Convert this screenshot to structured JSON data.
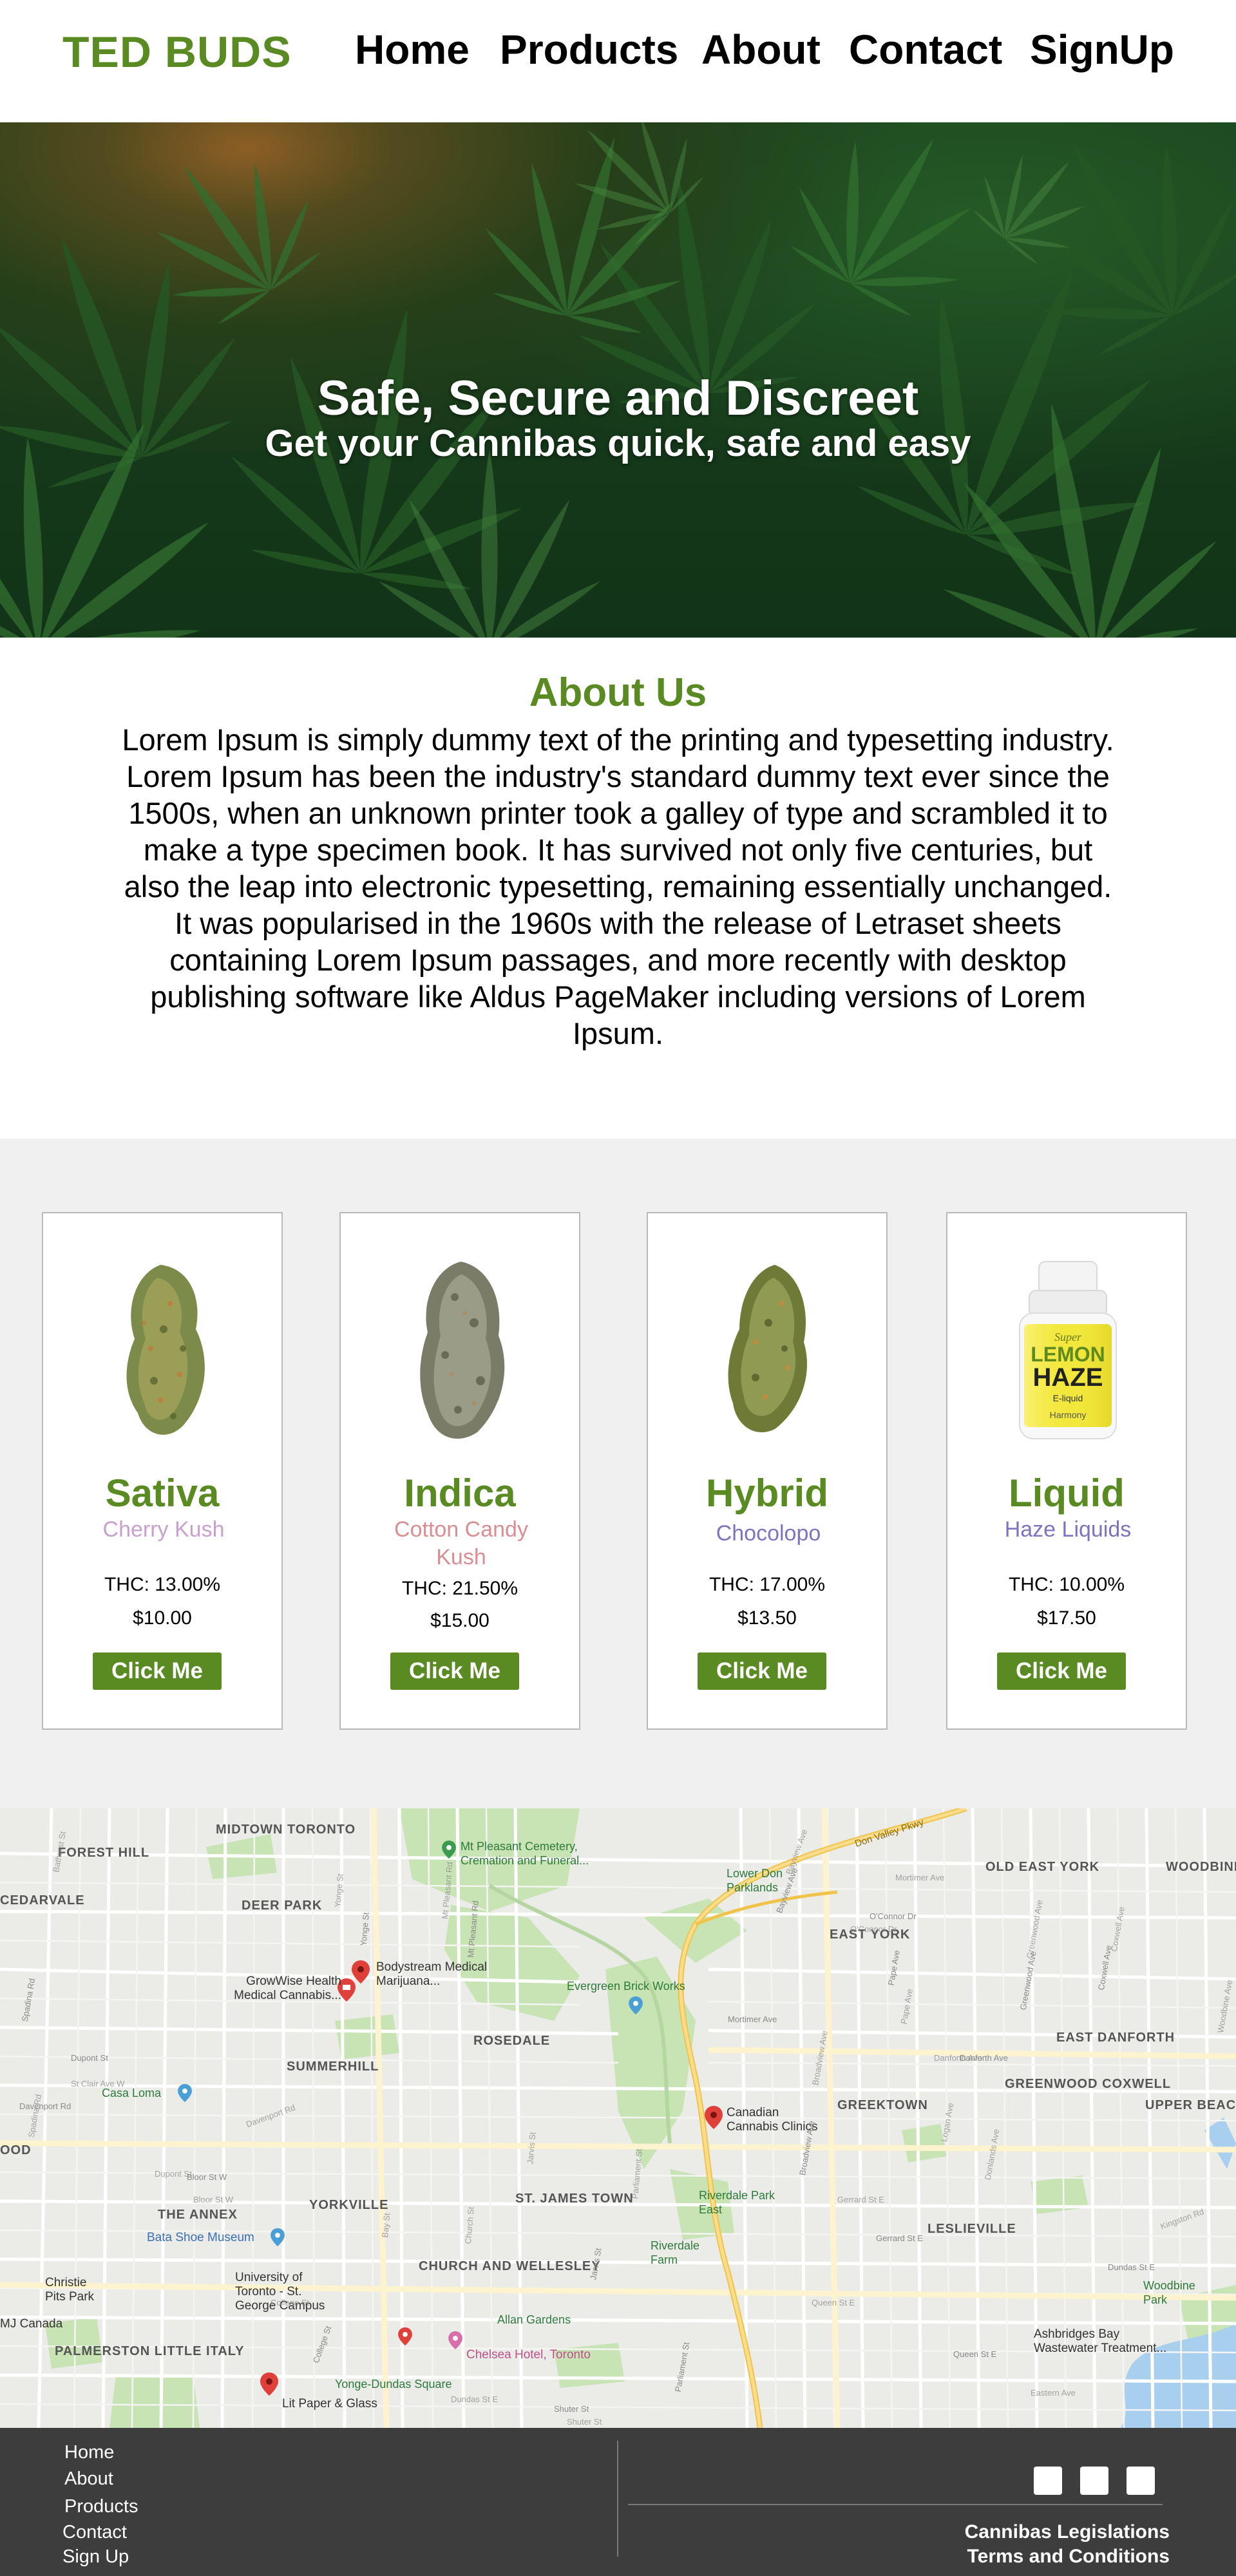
{
  "brand": {
    "name": "TED BUDS",
    "accent": "#5a8a22"
  },
  "nav": {
    "items": [
      "Home",
      "Products",
      "About",
      "Contact",
      "SignUp"
    ]
  },
  "hero": {
    "title": "Safe, Secure and Discreet",
    "subtitle": "Get your Cannibas quick, safe and easy"
  },
  "about": {
    "title": "About Us",
    "lines": [
      "Lorem Ipsum is simply dummy text of the printing and typesetting industry.",
      "Lorem Ipsum has been the industry's standard dummy text ever since the",
      "1500s, when an unknown printer took a galley of type and scrambled it to",
      "make a type specimen book. It has survived not only five centuries, but",
      "also the leap into electronic typesetting, remaining essentially unchanged.",
      "It was popularised in the 1960s with the release of Letraset sheets",
      "containing Lorem Ipsum passages, and more recently with desktop",
      "publishing software like Aldus PageMaker including versions of Lorem",
      "Ipsum."
    ]
  },
  "products": [
    {
      "name": "Sativa",
      "strain": "Cherry Kush",
      "strain_color": "#c9a0cd",
      "thc": "THC: 13.00%",
      "price": "$10.00",
      "button": "Click Me",
      "image": "cannabis-bud-icon"
    },
    {
      "name": "Indica",
      "strain": "Cotton Candy Kush",
      "strain_color": "#d98e93",
      "thc": "THC: 21.50%",
      "price": "$15.00",
      "button": "Click Me",
      "image": "cannabis-bud-icon"
    },
    {
      "name": "Hybrid",
      "strain": "Chocolopo",
      "strain_color": "#7e73c0",
      "thc": "THC: 17.00%",
      "price": "$13.50",
      "button": "Click Me",
      "image": "cannabis-bud-icon"
    },
    {
      "name": "Liquid",
      "strain": "Haze Liquids",
      "strain_color": "#7e73c0",
      "thc": "THC: 10.00%",
      "price": "$17.50",
      "button": "Click Me",
      "image": "e-liquid-bottle-icon",
      "bottle": {
        "top": "Super",
        "line1": "LEMON",
        "line2": "HAZE",
        "type": "E-liquid",
        "maker": "Harmony"
      }
    }
  ],
  "map": {
    "areas": [
      "MIDTOWN TORONTO",
      "FOREST HILL",
      "DEER PARK",
      "CEDARVALE",
      "SUMMERHILL",
      "ROSEDALE",
      "THE ANNEX",
      "YORKVILLE",
      "ST. JAMES TOWN",
      "CHURCH AND WELLESLEY",
      "PALMERSTON LITTLE ITALY",
      "OLD EAST YORK",
      "EAST YORK",
      "WOODBINE - LUMSDE",
      "EAST DANFORTH",
      "GREENWOOD COXWELL",
      "GREEKTOWN",
      "UPPER BEACH",
      "LESLIEVILLE",
      "OOD"
    ],
    "places": [
      "Mt Pleasant Cemetery, Cremation and Funeral...",
      "Lower Don Parklands",
      "Bodystream Medical Marijuana...",
      "GrowWise Health Medical Cannabis...",
      "Evergreen Brick Works",
      "Casa Loma",
      "Canadian Cannabis Clinics",
      "Riverdale Park East",
      "Riverdale Farm",
      "Bata Shoe Museum",
      "University of Toronto - St. George Campus",
      "Christie Pits Park",
      "MJ Canada",
      "Allan Gardens",
      "Chelsea Hotel, Toronto",
      "Yonge-Dundas Square",
      "Lit Paper & Glass",
      "Woodbine Park",
      "Ashbridges Bay Wastewater Treatment..."
    ],
    "roads": [
      "Don Valley Pkwy",
      "Bayview Ave",
      "Danforth Ave",
      "Gerrard St E",
      "Queen St E",
      "Dundas St E",
      "Bloor St W",
      "College St",
      "Jarvis St",
      "Parliament St",
      "Broadview Ave",
      "Pape Ave",
      "Greenwood Ave",
      "Coxwell Ave",
      "Mortimer Ave",
      "Davenport Rd",
      "Dupont St",
      "Spadina Rd",
      "Shuter St",
      "O'Connor Dr",
      "Yonge St",
      "Mt Pleasant Rd"
    ],
    "street_labels": [
      "Bathurst St",
      "Spadina Rd",
      "Dupont St",
      "St Clair Ave W",
      "Davenport Rd",
      "Yonge St",
      "Mt Pleasant Rd",
      "Bloor St W",
      "Bay St",
      "College St",
      "Church St",
      "Jarvis St",
      "Parliament St",
      "Dundas St E",
      "Gerrard St E",
      "Queen St E",
      "Shuter St",
      "Bayview Ave",
      "Broadview Ave",
      "Pape Ave",
      "Danforth Ave",
      "Mortimer Ave",
      "Greenwood Ave",
      "Coxwell Ave",
      "O'Connor Dr",
      "Eastern Ave",
      "Logan Ave",
      "Donlands Ave",
      "Woodbine Ave",
      "Kingston Rd"
    ],
    "colors": {
      "base": "#ebebe8",
      "park": "#c8e3b4",
      "water": "#a9cfef",
      "highway": "#f5d27a",
      "pin_red": "#e0403a",
      "pin_green": "#3b9c4f"
    }
  },
  "footer": {
    "links": [
      "Home",
      "About",
      "Products",
      "Contact",
      "Sign Up"
    ],
    "social_icons": [
      "social-icon-1",
      "social-icon-2",
      "social-icon-3"
    ],
    "right_links": [
      "Cannibas Legislations",
      "Terms and Conditions"
    ]
  }
}
